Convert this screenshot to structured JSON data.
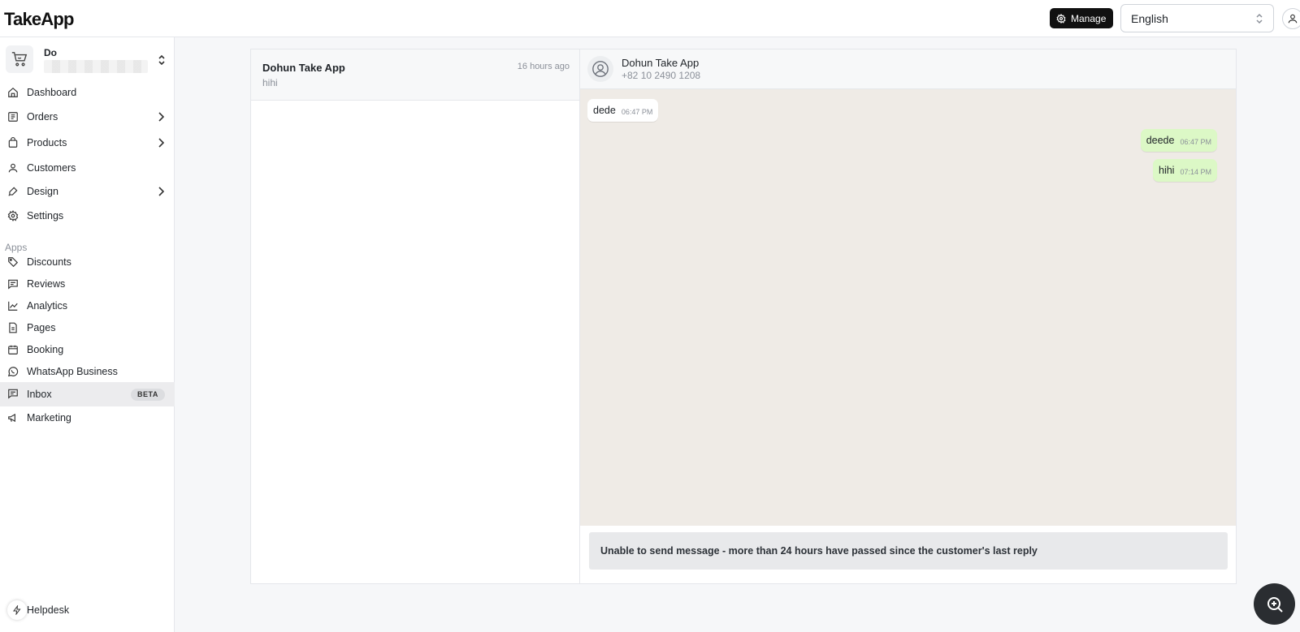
{
  "app": {
    "logo": "TakeApp"
  },
  "header": {
    "manage_label": "Manage",
    "language": "English"
  },
  "store": {
    "name": "Do"
  },
  "nav": {
    "main": [
      {
        "label": "Dashboard",
        "icon": "home-icon"
      },
      {
        "label": "Orders",
        "icon": "orders-icon",
        "expandable": true
      },
      {
        "label": "Products",
        "icon": "bag-icon",
        "expandable": true
      },
      {
        "label": "Customers",
        "icon": "user-icon"
      },
      {
        "label": "Design",
        "icon": "brush-icon",
        "expandable": true
      },
      {
        "label": "Settings",
        "icon": "gear-icon"
      }
    ],
    "apps_heading": "Apps",
    "apps": [
      {
        "label": "Discounts",
        "icon": "tag-icon"
      },
      {
        "label": "Reviews",
        "icon": "review-icon"
      },
      {
        "label": "Analytics",
        "icon": "chart-icon"
      },
      {
        "label": "Pages",
        "icon": "page-icon"
      },
      {
        "label": "Booking",
        "icon": "calendar-icon"
      },
      {
        "label": "WhatsApp Business",
        "icon": "whatsapp-icon"
      },
      {
        "label": "Inbox",
        "icon": "inbox-icon",
        "badge": "BETA",
        "active": true
      },
      {
        "label": "Marketing",
        "icon": "megaphone-icon"
      }
    ],
    "helpdesk": "Helpdesk"
  },
  "conversations": [
    {
      "name": "Dohun Take App",
      "preview": "hihi",
      "time": "16 hours ago"
    }
  ],
  "chat": {
    "contact_name": "Dohun Take App",
    "contact_phone": "+82 10 2490 1208",
    "messages": [
      {
        "text": "dede",
        "time": "06:47 PM",
        "direction": "in"
      },
      {
        "text": "deede",
        "time": "06:47 PM",
        "direction": "out"
      },
      {
        "text": "hihi",
        "time": "07:14 PM",
        "direction": "out"
      }
    ],
    "notice": "Unable to send message - more than 24 hours have passed since the customer's last reply"
  },
  "colors": {
    "outgoing_bubble": "#dcf8c6",
    "chat_background": "#efebe6",
    "active_nav": "#ececee"
  }
}
